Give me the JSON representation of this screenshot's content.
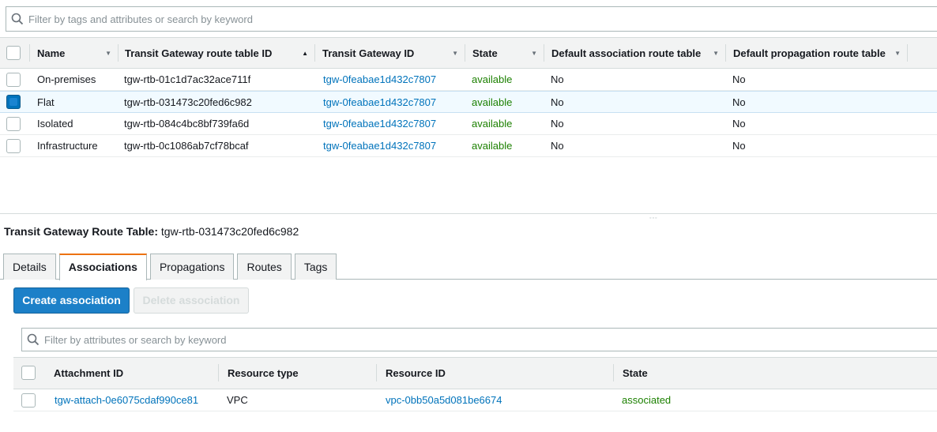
{
  "top_search": {
    "placeholder": "Filter by tags and attributes or search by keyword"
  },
  "top_table": {
    "columns": [
      "Name",
      "Transit Gateway route table ID",
      "Transit Gateway ID",
      "State",
      "Default association route table",
      "Default propagation route table"
    ],
    "rows": [
      {
        "name": "On-premises",
        "rtb_id": "tgw-rtb-01c1d7ac32ace711f",
        "tgw_id": "tgw-0feabae1d432c7807",
        "state": "available",
        "default_assoc": "No",
        "default_prop": "No",
        "selected": false
      },
      {
        "name": "Flat",
        "rtb_id": "tgw-rtb-031473c20fed6c982",
        "tgw_id": "tgw-0feabae1d432c7807",
        "state": "available",
        "default_assoc": "No",
        "default_prop": "No",
        "selected": true
      },
      {
        "name": "Isolated",
        "rtb_id": "tgw-rtb-084c4bc8bf739fa6d",
        "tgw_id": "tgw-0feabae1d432c7807",
        "state": "available",
        "default_assoc": "No",
        "default_prop": "No",
        "selected": false
      },
      {
        "name": "Infrastructure",
        "rtb_id": "tgw-rtb-0c1086ab7cf78bcaf",
        "tgw_id": "tgw-0feabae1d432c7807",
        "state": "available",
        "default_assoc": "No",
        "default_prop": "No",
        "selected": false
      }
    ]
  },
  "detail": {
    "title_label": "Transit Gateway Route Table:",
    "title_value": "tgw-rtb-031473c20fed6c982"
  },
  "tabs": [
    "Details",
    "Associations",
    "Propagations",
    "Routes",
    "Tags"
  ],
  "active_tab": "Associations",
  "actions": {
    "create": "Create association",
    "delete": "Delete association"
  },
  "bottom_search": {
    "placeholder": "Filter by attributes or search by keyword"
  },
  "bottom_table": {
    "columns": [
      "Attachment ID",
      "Resource type",
      "Resource ID",
      "State"
    ],
    "rows": [
      {
        "attachment_id": "tgw-attach-0e6075cdaf990ce81",
        "resource_type": "VPC",
        "resource_id": "vpc-0bb50a5d081be6674",
        "state": "associated"
      }
    ]
  },
  "colors": {
    "link": "#0073bb",
    "status_green": "#1d8102",
    "primary": "#1c80c8",
    "tab_accent": "#ec7211"
  },
  "icons": {
    "search": "search-icon",
    "sort_asc": "sort-ascending-icon",
    "sort": "sort-down-icon"
  }
}
